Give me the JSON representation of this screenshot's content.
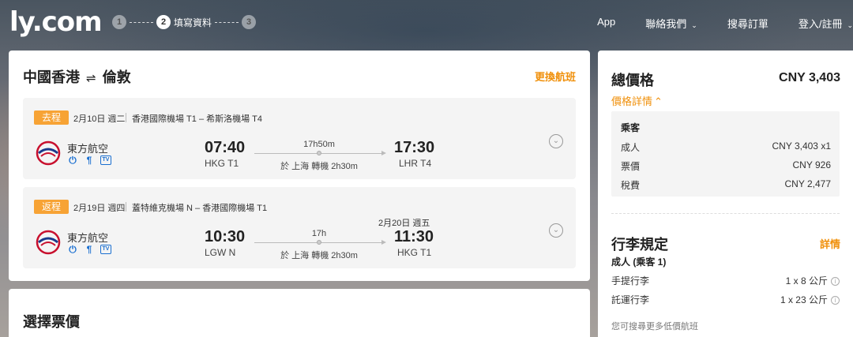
{
  "header": {
    "logo": "ly.com",
    "steps": [
      {
        "num": "1",
        "label": ""
      },
      {
        "num": "2",
        "label": "填寫資料"
      },
      {
        "num": "3",
        "label": ""
      }
    ],
    "nav": [
      {
        "label": "App",
        "dropdown": false
      },
      {
        "label": "聯絡我們",
        "dropdown": true
      },
      {
        "label": "搜尋訂單",
        "dropdown": false
      },
      {
        "label": "登入/註冊",
        "dropdown": true
      }
    ]
  },
  "itinerary": {
    "route_from": "中國香港",
    "route_arrow": "⇌",
    "route_to": "倫敦",
    "change_label": "更換航班",
    "segments": [
      {
        "tag": "去程",
        "date": "2月10日 週二",
        "airports": "香港國際機場 T1 – 希斯洛機場 T4",
        "airline": "東方航空",
        "dep_time": "07:40",
        "dep_airport": "HKG T1",
        "duration": "17h50m",
        "transfer": "於 上海 轉機 2h30m",
        "arr_time": "17:30",
        "arr_airport": "LHR T4",
        "arr_date": ""
      },
      {
        "tag": "返程",
        "date": "2月19日 週四",
        "airports": "蓋特維克機場 N – 香港國際機場 T1",
        "airline": "東方航空",
        "dep_time": "10:30",
        "dep_airport": "LGW N",
        "duration": "17h",
        "transfer": "於 上海 轉機 2h30m",
        "arr_time": "11:30",
        "arr_airport": "HKG T1",
        "arr_date": "2月20日 週五"
      }
    ]
  },
  "price": {
    "title": "總價格",
    "total": "CNY 3,403",
    "detail_label": "價格詳情",
    "detail_chevron": "^",
    "passenger_head": "乘客",
    "rows": [
      {
        "label": "成人",
        "value": "CNY 3,403 x1"
      },
      {
        "label": "票價",
        "value": "CNY 926"
      },
      {
        "label": "稅費",
        "value": "CNY 2,477"
      }
    ]
  },
  "baggage": {
    "title": "行李規定",
    "detail_label": "詳情",
    "subtitle": "成人 (乘客 1)",
    "rows": [
      {
        "label": "手提行李",
        "value": "1 x 8 公斤"
      },
      {
        "label": "託運行李",
        "value": "1 x 23 公斤"
      }
    ],
    "note": "您可搜尋更多低價航班"
  },
  "fare": {
    "title": "選擇票價"
  },
  "icons": [
    "power-plug-icon",
    "meal-icon",
    "tv-icon",
    "info-icon",
    "chevron-down-icon",
    "expand-icon"
  ],
  "colors": {
    "accent": "#f0900b",
    "tag": "#f7a335",
    "amenity": "#1a6fd0"
  }
}
